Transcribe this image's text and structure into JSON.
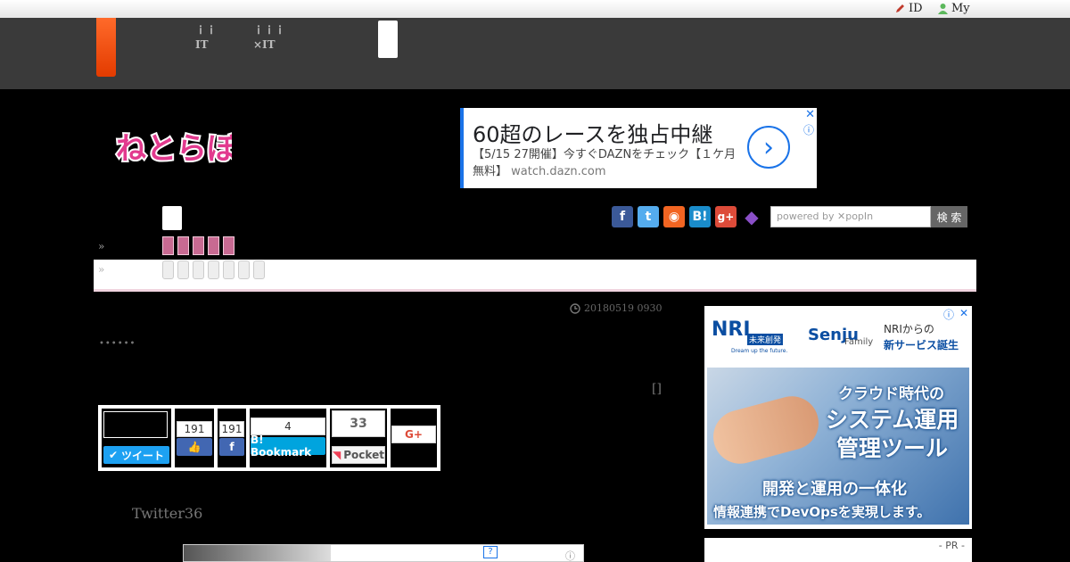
{
  "topbar": {
    "id_link": "ID",
    "my_link": "My"
  },
  "header": {
    "nav1_line1": "ｉｉ",
    "nav1_line2": "IT",
    "nav2_line1": "ｉｉｉ",
    "nav2_line2": "×IT"
  },
  "logo": {
    "text": "ねとらぼ"
  },
  "top_ad": {
    "headline": "60超のレースを独占中継",
    "body": "【5/15 27開催】今すぐDAZNをチェック【１ケ月無料】",
    "url": "watch.dazn.com",
    "close": "✕",
    "info": "ⓘ",
    "arrow": "›"
  },
  "social": {
    "icons": [
      "facebook-icon",
      "twitter-icon",
      "rss-icon",
      "hatena-icon",
      "googleplus-icon",
      "nekomimi-icon"
    ],
    "search_placeholder": "powered by ✕popIn",
    "search_button": "検 索"
  },
  "nav": {
    "chevron1": "»",
    "chevron2": "»"
  },
  "article": {
    "date": "20180519 0930",
    "dots": "••••••",
    "page_mark": "[]",
    "twitter_text": "Twitter36"
  },
  "share": {
    "tweet_label": "ツイート",
    "fb_like_count": "191",
    "fb_share_count": "191",
    "hatena_count": "4",
    "hatena_label": "B! Bookmark",
    "pocket_count": "33",
    "pocket_label": "Pocket",
    "gplus_label": "G+"
  },
  "side_ad": {
    "brand": "NRI",
    "brand_sub": "未来創発",
    "brand_tagline": "Dream up the future.",
    "product": "Senju",
    "product_sub": "Family",
    "promo_line1": "NRIからの",
    "promo_line2": "新サービス誕生",
    "line1": "クラウド時代の",
    "line2": "システム運用",
    "line3": "管理ツール",
    "line4": "開発と運用の一体化",
    "line5": "情報連携でDevOpsを実現します。",
    "info": "ⓘ",
    "close": "✕"
  },
  "pr_label": "- PR -",
  "colors": {
    "brand_orange": "#f04a10",
    "nav_pink": "#c86a92",
    "ad_blue": "#1a73e8",
    "twitter_blue": "#1da1f2",
    "facebook_blue": "#4267b2",
    "hatena_blue": "#00a4de",
    "pocket_red": "#ef4056",
    "gplus_red": "#dd4b39"
  }
}
